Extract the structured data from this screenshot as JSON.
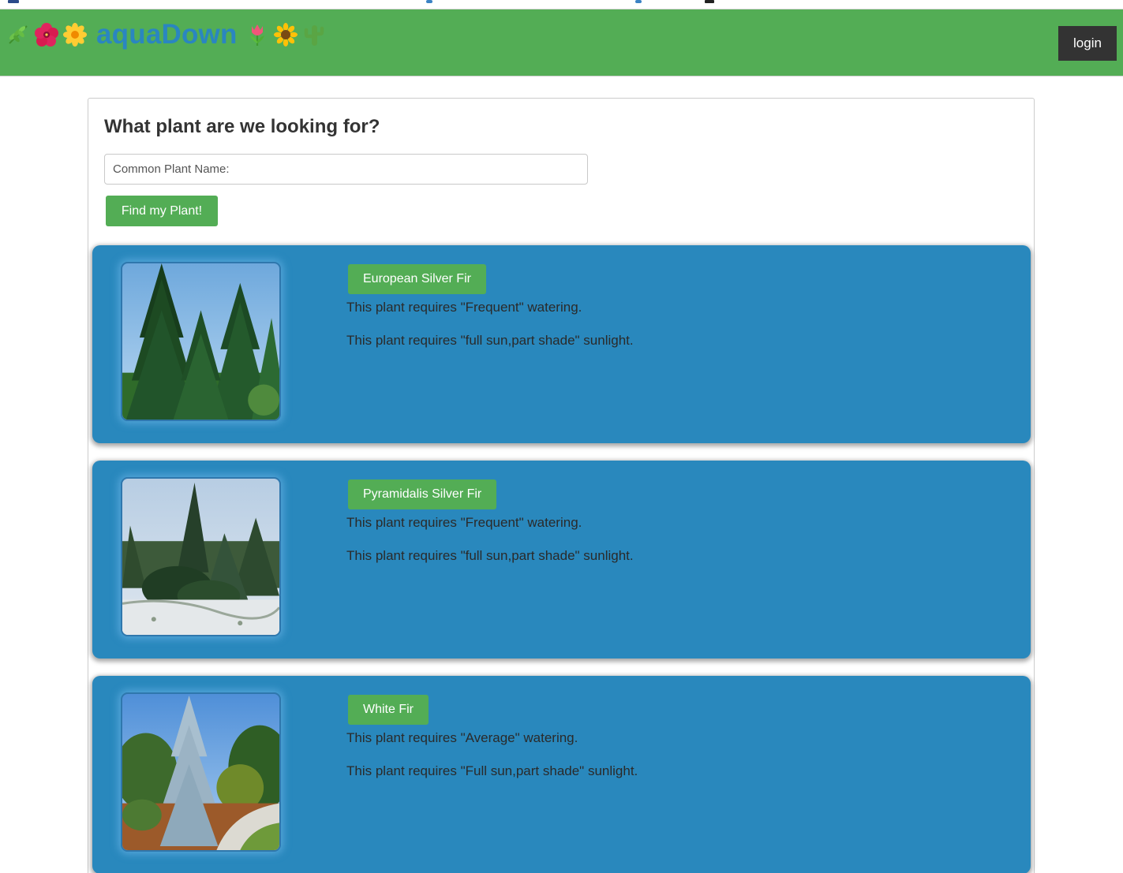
{
  "header": {
    "title": "aquaDown",
    "login_label": "login",
    "left_icons": [
      "herb-icon",
      "hibiscus-icon",
      "blossom-icon"
    ],
    "right_icons": [
      "tulip-icon",
      "sunflower-icon",
      "cactus-icon"
    ],
    "background_color": "#53ad55",
    "title_color": "#2a86c0"
  },
  "search": {
    "heading": "What plant are we looking for?",
    "placeholder": "Common Plant Name:",
    "value": "",
    "button_label": "Find my Plant!"
  },
  "results": [
    {
      "name": "European Silver Fir",
      "watering_text": "This plant requires \"Frequent\" watering.",
      "sunlight_text": "This plant requires \"full sun,part shade\" sunlight.",
      "image_icon": "fir-forest-photo"
    },
    {
      "name": "Pyramidalis Silver Fir",
      "watering_text": "This plant requires \"Frequent\" watering.",
      "sunlight_text": "This plant requires \"full sun,part shade\" sunlight.",
      "image_icon": "fir-snow-photo"
    },
    {
      "name": "White Fir",
      "watering_text": "This plant requires \"Average\" watering.",
      "sunlight_text": "This plant requires \"Full sun,part shade\" sunlight.",
      "image_icon": "blue-fir-photo"
    }
  ],
  "colors": {
    "card_background": "#2988bd",
    "button_green": "#53ad55",
    "login_background": "#333333"
  }
}
